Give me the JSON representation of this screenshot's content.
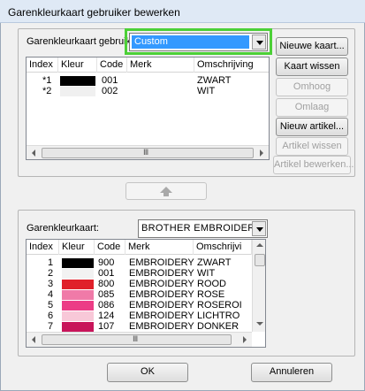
{
  "window": {
    "title": "Garenkleurkaart gebruiker bewerken"
  },
  "user_chart": {
    "label": "Garenkleurkaart gebruiker:",
    "selected": "Custom",
    "columns": [
      "Index",
      "Kleur",
      "Code",
      "Merk",
      "Omschrijving"
    ],
    "rows": [
      {
        "index": "*1",
        "color": "#000000",
        "code": "001",
        "brand": "",
        "desc": "ZWART"
      },
      {
        "index": "*2",
        "color": "#f0f0f0",
        "code": "002",
        "brand": "",
        "desc": "WIT"
      }
    ],
    "buttons": {
      "new_chart": "Nieuwe kaart...",
      "delete_chart": "Kaart wissen",
      "move_up": "Omhoog",
      "move_down": "Omlaag",
      "new_item": "Nieuw artikel...",
      "delete_item": "Artikel wissen",
      "edit_item": "Artikel bewerken..."
    }
  },
  "source_chart": {
    "label": "Garenkleurkaart:",
    "selected": "BROTHER EMBROIDERY",
    "columns": [
      "Index",
      "Kleur",
      "Code",
      "Merk",
      "Omschrijvi"
    ],
    "rows": [
      {
        "index": "1",
        "color": "#000000",
        "code": "900",
        "brand": "EMBROIDERY",
        "desc": "ZWART"
      },
      {
        "index": "2",
        "color": "#f2f2f2",
        "code": "001",
        "brand": "EMBROIDERY",
        "desc": "WIT"
      },
      {
        "index": "3",
        "color": "#e0202a",
        "code": "800",
        "brand": "EMBROIDERY",
        "desc": "ROOD"
      },
      {
        "index": "4",
        "color": "#f07aa8",
        "code": "085",
        "brand": "EMBROIDERY",
        "desc": "ROSE"
      },
      {
        "index": "5",
        "color": "#ec3d86",
        "code": "086",
        "brand": "EMBROIDERY",
        "desc": "ROSEROI"
      },
      {
        "index": "6",
        "color": "#f8c8d8",
        "code": "124",
        "brand": "EMBROIDERY",
        "desc": "LICHTRO"
      },
      {
        "index": "7",
        "color": "#c8145a",
        "code": "107",
        "brand": "EMBROIDERY",
        "desc": "DONKER"
      }
    ]
  },
  "footer": {
    "ok": "OK",
    "cancel": "Annuleren"
  }
}
